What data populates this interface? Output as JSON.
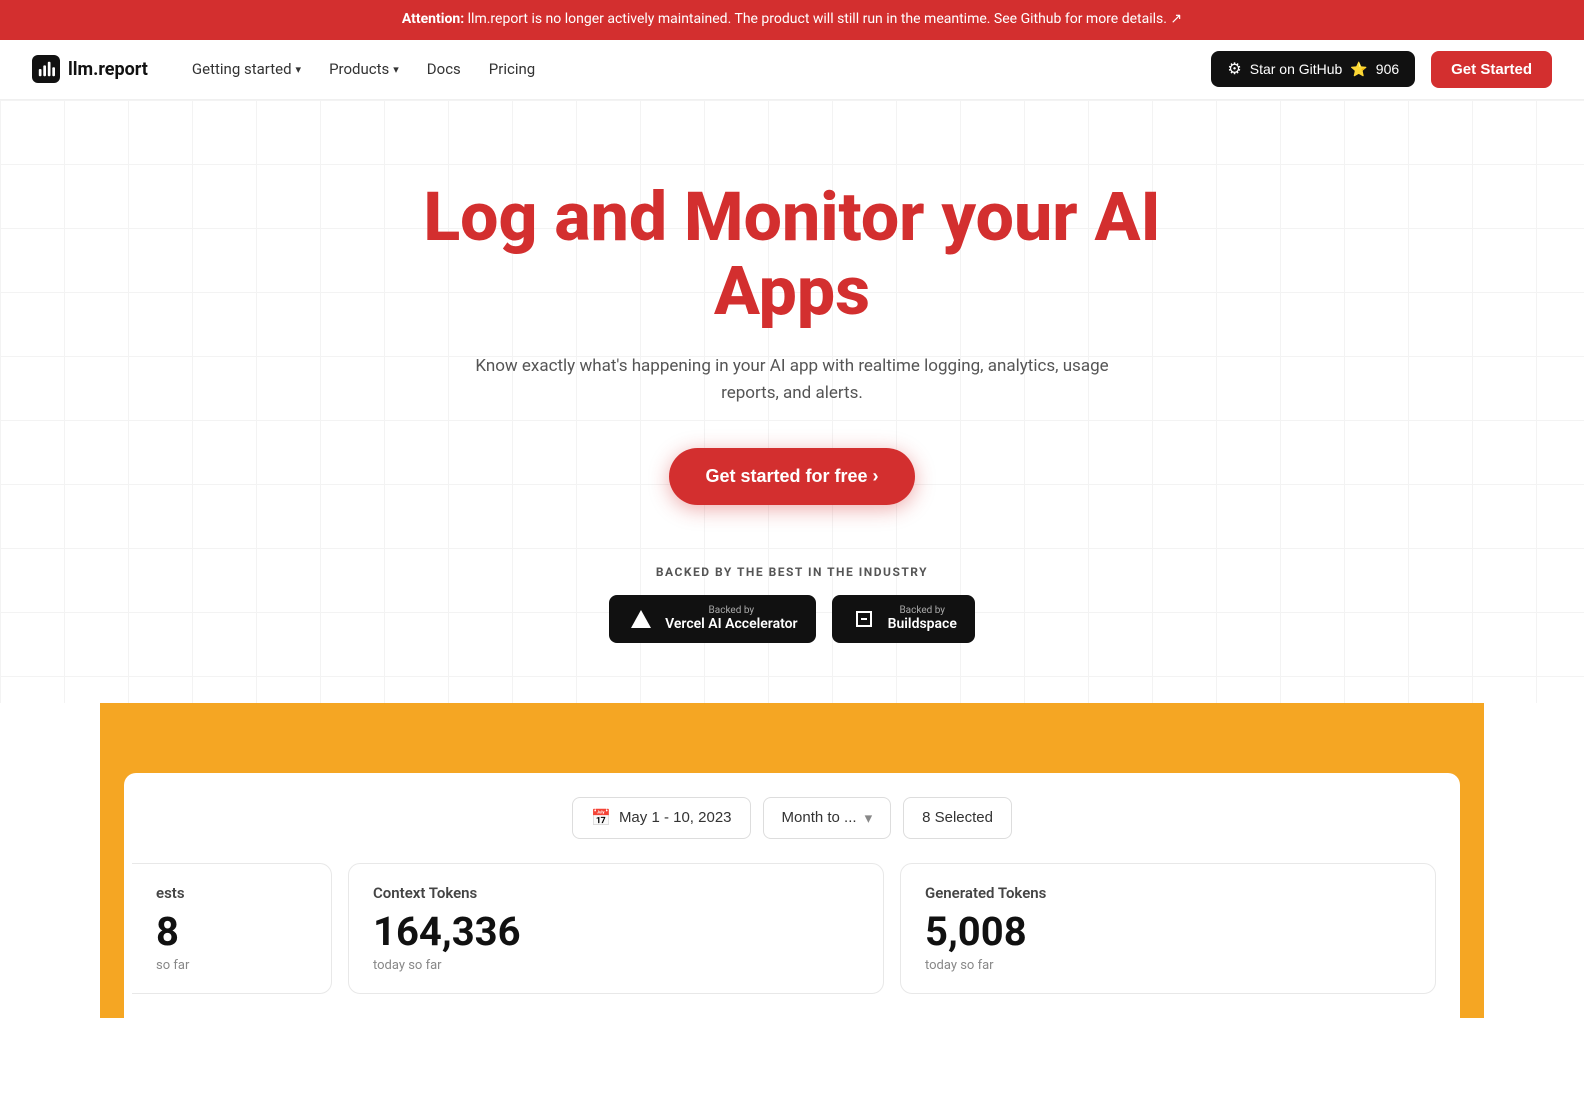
{
  "attention": {
    "text": "Attention:",
    "message": " llm.report is no longer actively maintained. The product will still run in the meantime. See Github for more details.",
    "link_text": "↗"
  },
  "navbar": {
    "logo_text": "llm.report",
    "getting_started": "Getting started",
    "products": "Products",
    "docs": "Docs",
    "pricing": "Pricing",
    "github_label": "Star on GitHub",
    "github_star": "⭐",
    "github_count": "906",
    "get_started_label": "Get Started"
  },
  "hero": {
    "title": "Log and Monitor your AI Apps",
    "subtitle": "Know exactly what's happening in your AI app with realtime logging, analytics, usage reports, and alerts.",
    "cta_label": "Get started for free ›"
  },
  "backed": {
    "label": "BACKED BY THE BEST IN THE INDUSTRY",
    "logos": [
      {
        "backed_by": "Backed by",
        "name": "Vercel AI Accelerator"
      },
      {
        "backed_by": "Backed by",
        "name": "Buildspace"
      }
    ]
  },
  "dashboard": {
    "date_filter": "May 1 - 10, 2023",
    "period_filter": "Month to ...",
    "selected_filter": "8 Selected",
    "stats": [
      {
        "label": "ests",
        "value": "8",
        "sub": "so far"
      },
      {
        "label": "Context Tokens",
        "value": "164,336",
        "sub": "today so far"
      },
      {
        "label": "Generated Tokens",
        "value": "5,008",
        "sub": "today so far"
      }
    ]
  }
}
